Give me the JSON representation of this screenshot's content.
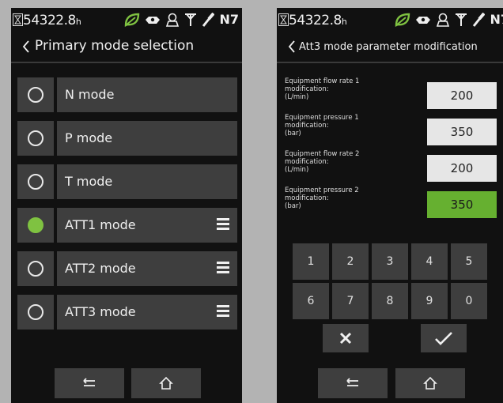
{
  "status": {
    "hours_value": "54322.8",
    "hours_unit": "h",
    "indicator": "N7",
    "icons": [
      "hourglass-icon",
      "eco-leaf-icon",
      "engine-icon",
      "operator-icon",
      "antenna-icon",
      "wrench-icon"
    ],
    "eco_color": "#7fc241"
  },
  "screen1": {
    "title": "Primary mode selection",
    "modes": [
      {
        "label": "N mode",
        "selected": false,
        "has_menu": false
      },
      {
        "label": "P mode",
        "selected": false,
        "has_menu": false
      },
      {
        "label": "T mode",
        "selected": false,
        "has_menu": false
      },
      {
        "label": "ATT1 mode",
        "selected": true,
        "has_menu": true
      },
      {
        "label": "ATT2 mode",
        "selected": false,
        "has_menu": true
      },
      {
        "label": "ATT3 mode",
        "selected": false,
        "has_menu": true
      }
    ],
    "nav": [
      "back-icon",
      "home-icon"
    ]
  },
  "screen2": {
    "title": "Att3 mode parameter modification",
    "params": [
      {
        "l1": "Equipment flow rate 1",
        "l2": "modification:",
        "l3": "(L/min)",
        "value": "200",
        "active": false
      },
      {
        "l1": "Equipment pressure 1",
        "l2": "modification:",
        "l3": "(bar)",
        "value": "350",
        "active": false
      },
      {
        "l1": "Equipment flow rate 2",
        "l2": "modification:",
        "l3": "(L/min)",
        "value": "200",
        "active": false
      },
      {
        "l1": "Equipment pressure 2",
        "l2": "modification:",
        "l3": "(bar)",
        "value": "350",
        "active": true
      }
    ],
    "keypad": [
      "1",
      "2",
      "3",
      "4",
      "5",
      "6",
      "7",
      "8",
      "9",
      "0"
    ],
    "actions": [
      "cancel-icon",
      "confirm-icon"
    ],
    "nav": [
      "back-icon",
      "home-icon"
    ],
    "active_color": "#66b030"
  }
}
